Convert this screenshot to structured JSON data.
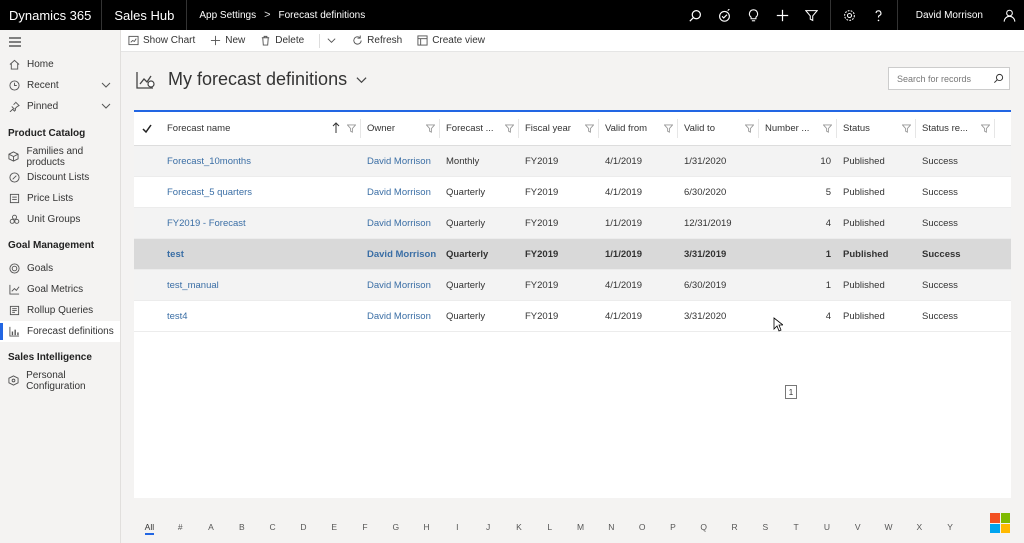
{
  "topbar": {
    "brand": "Dynamics 365",
    "app": "Sales Hub",
    "crumb1": "App Settings",
    "crumb_sep": ">",
    "crumb2": "Forecast definitions",
    "user": "David Morrison"
  },
  "sidebar": {
    "items": [
      {
        "label": "Home",
        "icon": "home-icon"
      },
      {
        "label": "Recent",
        "icon": "clock-icon"
      },
      {
        "label": "Pinned",
        "icon": "pin-icon"
      }
    ],
    "groups": [
      {
        "title": "Product Catalog",
        "items": [
          {
            "label": "Families and products",
            "icon": "product-icon"
          },
          {
            "label": "Discount Lists",
            "icon": "discount-icon"
          },
          {
            "label": "Price Lists",
            "icon": "pricelist-icon"
          },
          {
            "label": "Unit Groups",
            "icon": "unitgroup-icon"
          }
        ]
      },
      {
        "title": "Goal Management",
        "items": [
          {
            "label": "Goals",
            "icon": "target-icon"
          },
          {
            "label": "Goal Metrics",
            "icon": "metric-icon"
          },
          {
            "label": "Rollup Queries",
            "icon": "query-icon"
          },
          {
            "label": "Forecast definitions",
            "icon": "forecast-icon",
            "active": true
          }
        ]
      },
      {
        "title": "Sales Intelligence",
        "items": [
          {
            "label": "Personal Configuration",
            "icon": "config-icon"
          }
        ]
      }
    ]
  },
  "commands": {
    "show_chart": "Show Chart",
    "new": "New",
    "delete": "Delete",
    "refresh": "Refresh",
    "create_view": "Create view"
  },
  "view": {
    "title": "My forecast definitions",
    "search_placeholder": "Search for records"
  },
  "grid": {
    "columns": [
      "Forecast name",
      "Owner",
      "Forecast ...",
      "Fiscal year",
      "Valid from",
      "Valid to",
      "Number ...",
      "Status",
      "Status re..."
    ],
    "rows": [
      [
        "Forecast_10months",
        "David Morrison",
        "Monthly",
        "FY2019",
        "4/1/2019",
        "1/31/2020",
        "10",
        "Published",
        "Success"
      ],
      [
        "Forecast_5 quarters",
        "David Morrison",
        "Quarterly",
        "FY2019",
        "4/1/2019",
        "6/30/2020",
        "5",
        "Published",
        "Success"
      ],
      [
        "FY2019 - Forecast",
        "David Morrison",
        "Quarterly",
        "FY2019",
        "1/1/2019",
        "12/31/2019",
        "4",
        "Published",
        "Success"
      ],
      [
        "test",
        "David Morrison",
        "Quarterly",
        "FY2019",
        "1/1/2019",
        "3/31/2019",
        "1",
        "Published",
        "Success"
      ],
      [
        "test_manual",
        "David Morrison",
        "Quarterly",
        "FY2019",
        "4/1/2019",
        "6/30/2019",
        "1",
        "Published",
        "Success"
      ],
      [
        "test4",
        "David Morrison",
        "Quarterly",
        "FY2019",
        "4/1/2019",
        "3/31/2020",
        "4",
        "Published",
        "Success"
      ]
    ],
    "tooltip": "1"
  },
  "alpha": [
    "All",
    "#",
    "A",
    "B",
    "C",
    "D",
    "E",
    "F",
    "G",
    "H",
    "I",
    "J",
    "K",
    "L",
    "M",
    "N",
    "O",
    "P",
    "Q",
    "R",
    "S",
    "T",
    "U",
    "V",
    "W",
    "X",
    "Y"
  ],
  "colors": {
    "accent": "#2266e3",
    "link": "#3a6ea5",
    "topbar": "#000000"
  }
}
